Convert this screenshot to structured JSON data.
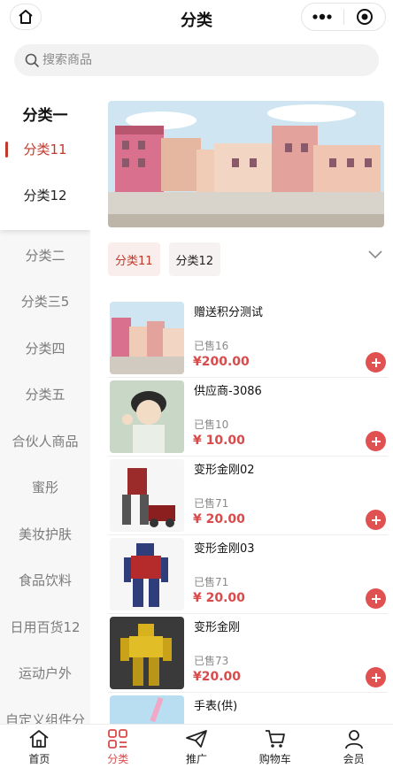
{
  "header": {
    "title": "分类"
  },
  "search": {
    "placeholder": "搜索商品"
  },
  "sidebar": {
    "group_title": "分类一",
    "sub_items": [
      "分类11",
      "分类12"
    ],
    "items": [
      "分类二",
      "分类三5",
      "分类四",
      "分类五",
      "合伙人商品",
      "蜜彤",
      "美妆护肤",
      "食品饮料",
      "日用百货12",
      "运动户外",
      "自定义组件分"
    ]
  },
  "subtabs": [
    "分类11",
    "分类12"
  ],
  "products": [
    {
      "name": "赠送积分测试",
      "sold": "已售16",
      "price": "¥200.00",
      "thumb": "town-image"
    },
    {
      "name": "供应商-3086",
      "sold": "已售10",
      "price": "¥ 10.00",
      "thumb": "anime-character-image"
    },
    {
      "name": "变形金刚02",
      "sold": "已售71",
      "price": "¥ 20.00",
      "thumb": "robot-red-image"
    },
    {
      "name": "变形金刚03",
      "sold": "已售71",
      "price": "¥ 20.00",
      "thumb": "robot-blue-image"
    },
    {
      "name": "变形金刚",
      "sold": "已售73",
      "price": "¥20.00",
      "thumb": "robot-yellow-image"
    },
    {
      "name": "手表(供)",
      "sold": "",
      "price": "",
      "thumb": "watch-image"
    }
  ],
  "tabbar": [
    {
      "label": "首页",
      "icon": "home-icon"
    },
    {
      "label": "分类",
      "icon": "category-icon"
    },
    {
      "label": "推广",
      "icon": "paper-plane-icon"
    },
    {
      "label": "购物车",
      "icon": "cart-icon"
    },
    {
      "label": "会员",
      "icon": "user-icon"
    }
  ],
  "colors": {
    "accent": "#d94b4b",
    "active_text": "#c0392b",
    "sidebar_bg": "#f7f7f7"
  }
}
